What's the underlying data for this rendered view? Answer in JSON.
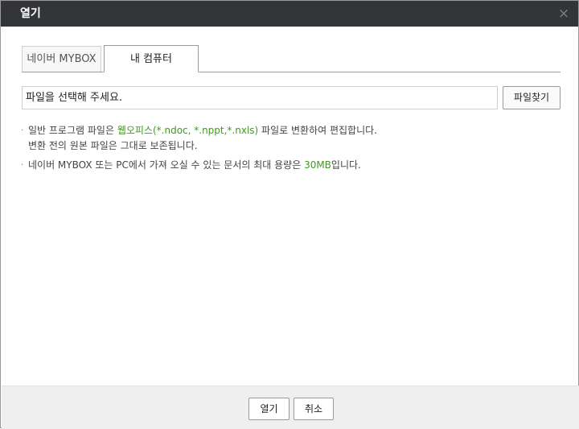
{
  "dialog": {
    "title": "열기",
    "close_icon": "×"
  },
  "tabs": [
    {
      "label": "네이버 MYBOX",
      "active": false
    },
    {
      "label": "내 컴퓨터",
      "active": true
    }
  ],
  "file": {
    "value": "파일을 선택해 주세요.",
    "find_button": "파일찾기"
  },
  "notes": {
    "bullet": "·",
    "note1_prefix": "일반 프로그램 파일은 ",
    "note1_highlight": "웹오피스(*.ndoc, *.nppt,*.nxls)",
    "note1_suffix": " 파일로 변환하여 편집합니다.",
    "note1_line2": "변환 전의 원본 파일은 그대로 보존됩니다.",
    "note2_prefix": "네이버 MYBOX 또는 PC에서 가져 오실 수 있는 문서의 최대 용량은 ",
    "note2_highlight": "30MB",
    "note2_suffix": "입니다."
  },
  "footer": {
    "open_label": "열기",
    "cancel_label": "취소"
  },
  "colors": {
    "titlebar": "#333538",
    "highlight": "#3e9b1c",
    "footer": "#efefef"
  }
}
